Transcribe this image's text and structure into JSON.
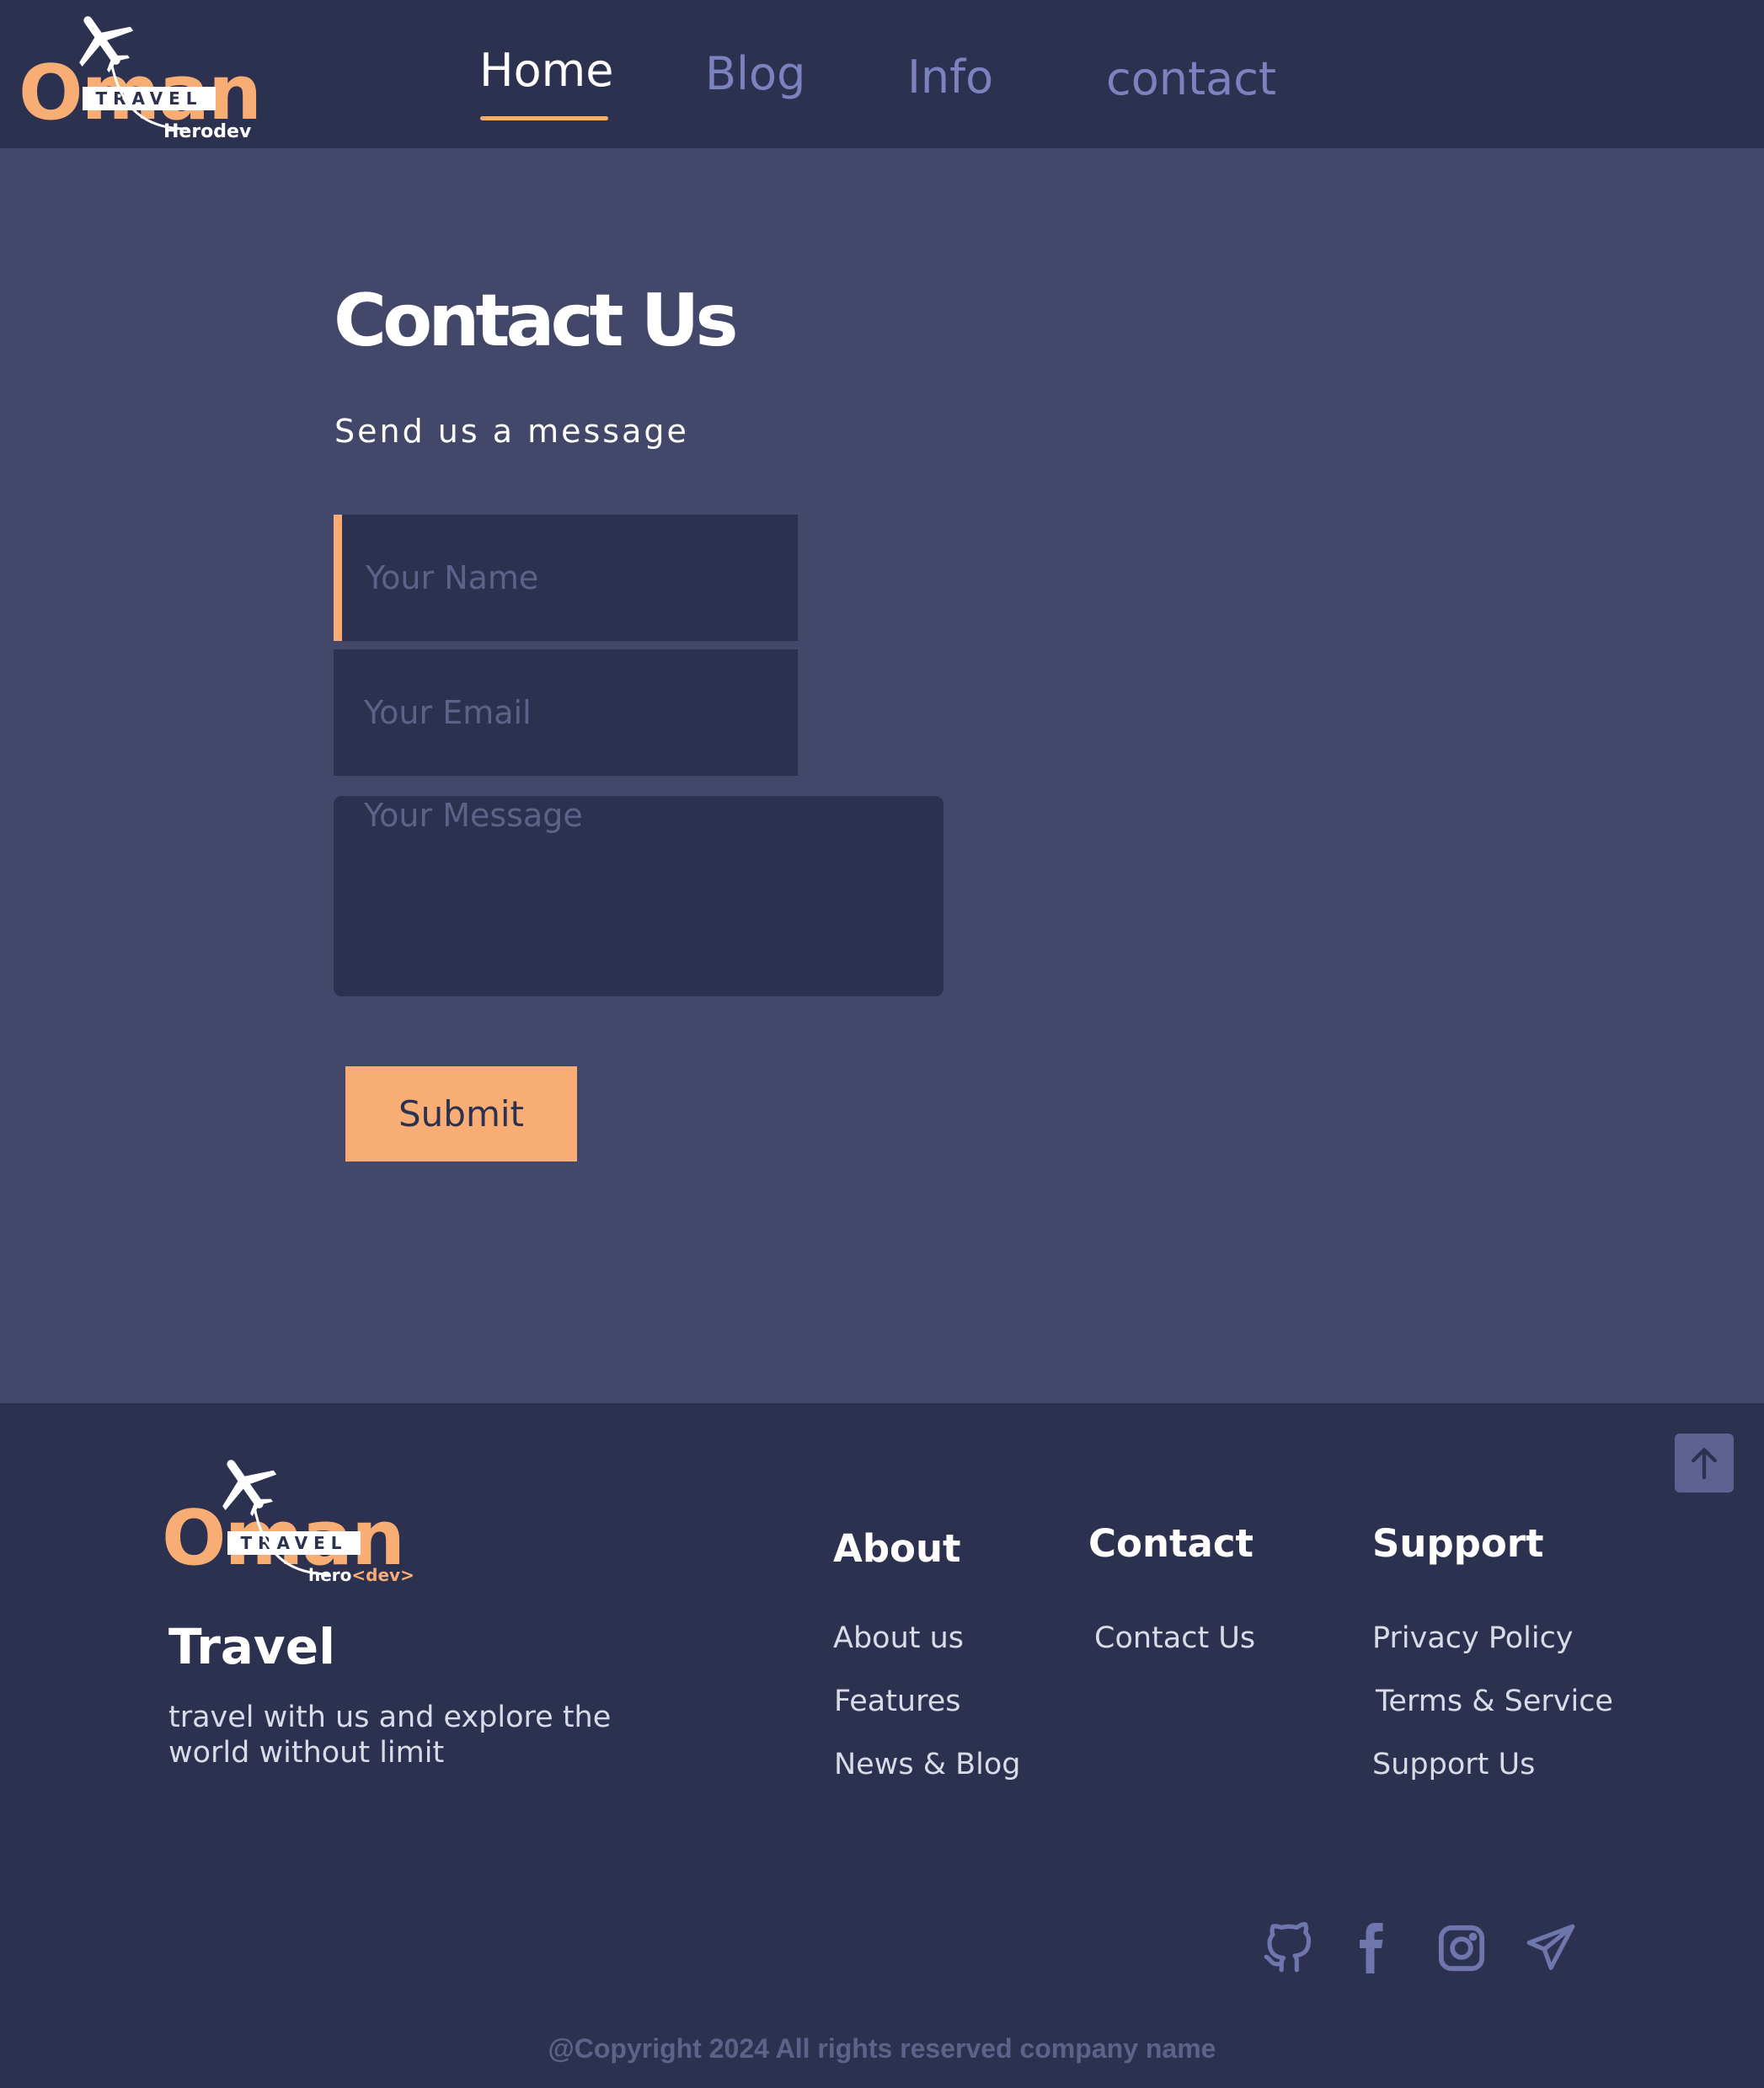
{
  "colors": {
    "header_bg": "#2d3150",
    "main_bg": "#43476a",
    "accent": "#f8ad75",
    "nav_inactive": "#7c82c0",
    "placeholder": "#5d6288",
    "top_button": "#5d6290"
  },
  "header": {
    "logo": {
      "word": "Oman",
      "badge": "TRAVEL",
      "sub": "Herodev",
      "icon": "airplane-icon"
    },
    "nav": [
      {
        "label": "Home",
        "active": true
      },
      {
        "label": "Blog",
        "active": false
      },
      {
        "label": "Info",
        "active": false
      },
      {
        "label": "contact",
        "active": false
      }
    ]
  },
  "main": {
    "title": "Contact Us",
    "subtitle": "Send us a message",
    "form": {
      "name_placeholder": "Your Name",
      "email_placeholder": "Your Email",
      "message_placeholder": "Your Message",
      "submit_label": "Submit"
    }
  },
  "footer": {
    "logo": {
      "word": "Oman",
      "badge": "TRAVEL",
      "sub_main": "hero",
      "sub_accent": "<dev>",
      "icon": "airplane-icon"
    },
    "brand": "Travel",
    "tagline": "travel with us and explore the world without limit",
    "columns": [
      {
        "heading": "About",
        "links": [
          "About us",
          "Features",
          "News & Blog"
        ]
      },
      {
        "heading": "Contact",
        "links": [
          "Contact Us"
        ]
      },
      {
        "heading": "Support",
        "links": [
          "Privacy Policy",
          "Terms & Service",
          "Support Us"
        ]
      }
    ],
    "social_icons": [
      "github-icon",
      "facebook-icon",
      "instagram-icon",
      "telegram-icon"
    ],
    "copyright": "@Copyright 2024 All rights reserved company name",
    "scroll_top_icon": "arrow-up-icon"
  }
}
